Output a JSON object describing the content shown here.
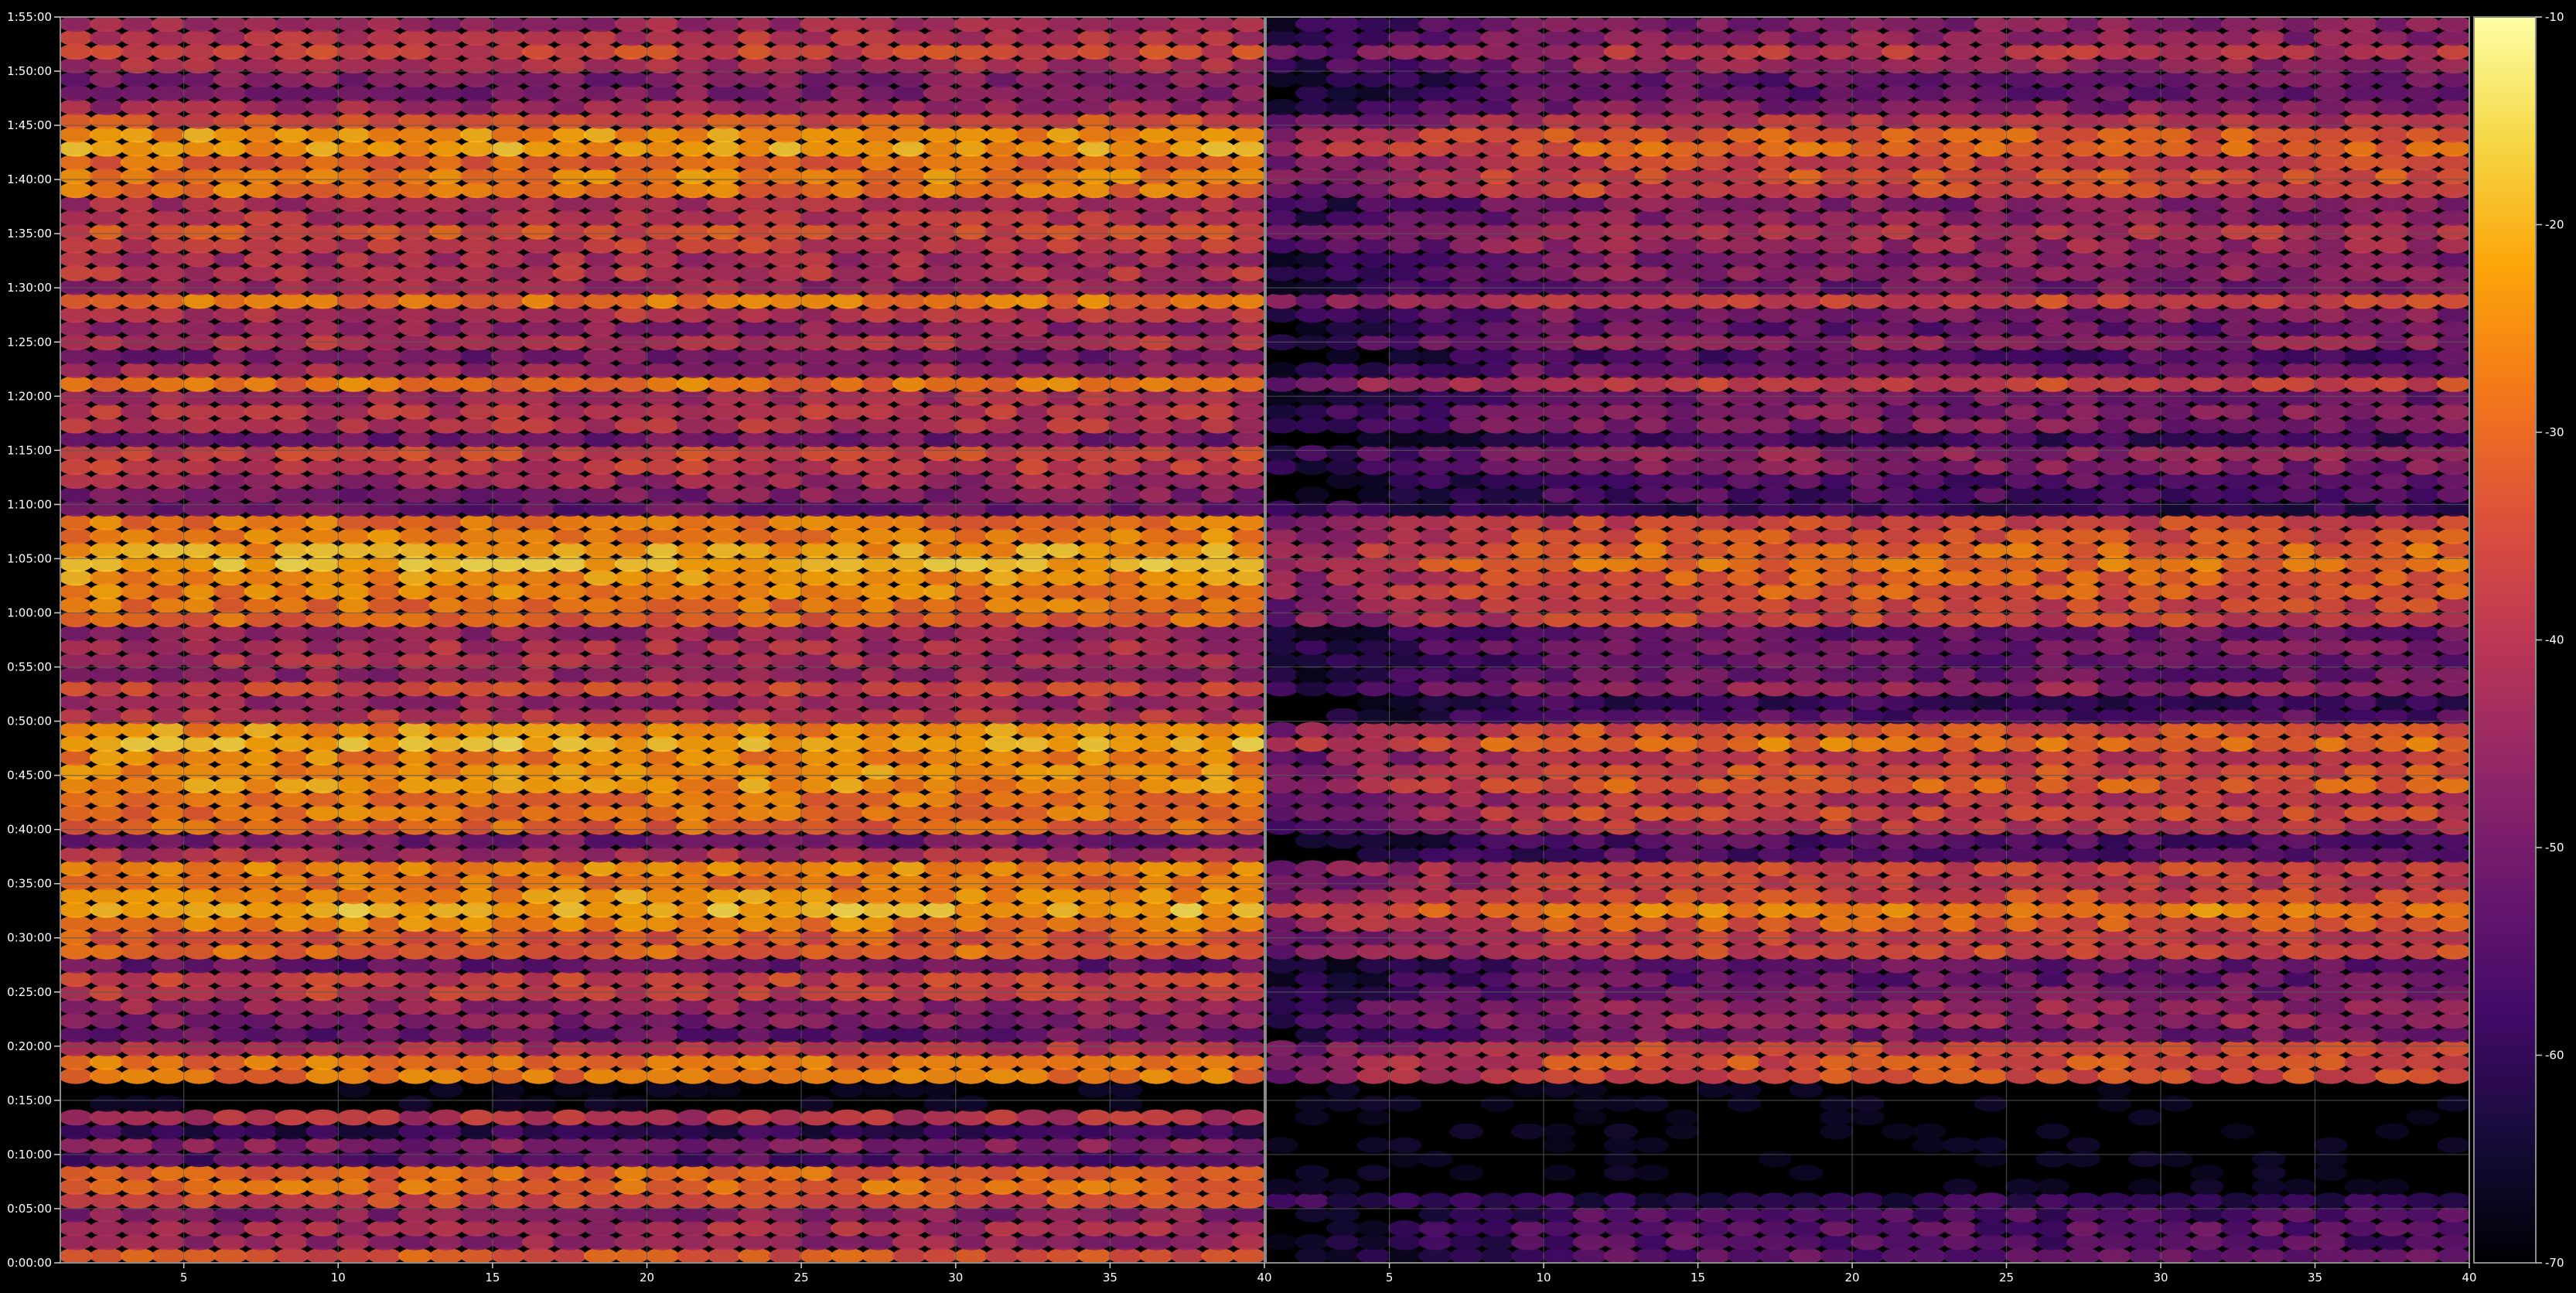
{
  "chart_data": {
    "type": "heatmap",
    "panels": [
      {
        "name": "",
        "x_range": [
          1,
          40
        ],
        "x_ticks": [
          "5",
          "10",
          "15",
          "20",
          "25",
          "30",
          "35",
          "40"
        ],
        "row_intensities": [
          -33,
          -45,
          -42,
          -47,
          -35,
          -28,
          -30,
          -55,
          -48,
          -60,
          -40,
          -70,
          -70,
          -28,
          -28,
          -40,
          -52,
          -48,
          -45,
          -38,
          -37,
          -52,
          -30,
          -32,
          -26,
          -20,
          -24,
          -28,
          -25,
          -42,
          -50,
          -30,
          -28,
          -28,
          -24,
          -24,
          -26,
          -20,
          -24,
          -40,
          -44,
          -36,
          -45,
          -42,
          -42,
          -45,
          -30,
          -28,
          -26,
          -24,
          -20,
          -22,
          -26,
          -28,
          -52,
          -48,
          -44,
          -38,
          -36,
          -50,
          -40,
          -40,
          -42,
          -28,
          -44,
          -50,
          -40,
          -46,
          -40,
          -28,
          -44,
          -40,
          -42,
          -38,
          -34,
          -40,
          -42,
          -28,
          -26,
          -30,
          -22,
          -24,
          -34,
          -44,
          -48,
          -48,
          -42,
          -36,
          -40,
          -44
        ],
        "leading_fade": 0
      },
      {
        "name": "",
        "x_range": [
          1,
          40
        ],
        "x_ticks": [
          "5",
          "10",
          "15",
          "20",
          "25",
          "30",
          "35",
          "40"
        ],
        "row_intensities": [
          -54,
          -55,
          -54,
          -56,
          -60,
          -70,
          -70,
          -70,
          -70,
          -70,
          -70,
          -70,
          -70,
          -34,
          -34,
          -36,
          -50,
          -45,
          -45,
          -50,
          -52,
          -52,
          -36,
          -38,
          -32,
          -26,
          -35,
          -38,
          -36,
          -55,
          -55,
          -40,
          -36,
          -40,
          -32,
          -34,
          -38,
          -28,
          -34,
          -55,
          -58,
          -46,
          -52,
          -52,
          -50,
          -52,
          -36,
          -36,
          -32,
          -32,
          -28,
          -30,
          -34,
          -36,
          -60,
          -56,
          -54,
          -48,
          -46,
          -58,
          -48,
          -48,
          -50,
          -36,
          -50,
          -55,
          -46,
          -52,
          -48,
          -36,
          -50,
          -46,
          -48,
          -44,
          -40,
          -46,
          -48,
          -36,
          -34,
          -36,
          -30,
          -32,
          -40,
          -48,
          -52,
          -52,
          -46,
          -40,
          -46,
          -48
        ],
        "leading_fade": 0.25
      }
    ],
    "y_ticks": [
      "0:00:00",
      "0:05:00",
      "0:10:00",
      "0:15:00",
      "0:20:00",
      "0:25:00",
      "0:30:00",
      "0:35:00",
      "0:40:00",
      "0:45:00",
      "0:50:00",
      "0:55:00",
      "1:00:00",
      "1:05:00",
      "1:10:00",
      "1:15:00",
      "1:20:00",
      "1:25:00",
      "1:30:00",
      "1:35:00",
      "1:40:00",
      "1:45:00",
      "1:50:00",
      "1:55:00"
    ],
    "y_range_seconds": [
      0,
      6900
    ],
    "colorbar": {
      "range": [
        -70,
        -10
      ],
      "ticks": [
        "-10",
        "-20",
        "-30",
        "-40",
        "-50",
        "-60",
        "-70"
      ],
      "colormap": "inferno"
    },
    "grid": true,
    "background": "#000000",
    "grid_color": "#5a5a5a",
    "text_color": "#ffffff"
  }
}
